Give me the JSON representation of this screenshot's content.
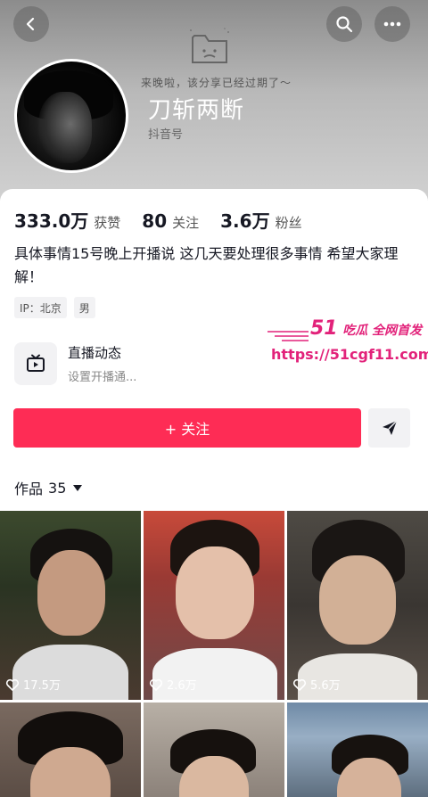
{
  "header": {
    "expired_text": "来晚啦，该分享已经过期了～",
    "nickname": "刀斩两断",
    "douyin_id_label": "抖音号"
  },
  "stats": [
    {
      "value": "333.0万",
      "label": "获赞"
    },
    {
      "value": "80",
      "label": "关注"
    },
    {
      "value": "3.6万",
      "label": "粉丝"
    }
  ],
  "bio": "具体事情15号晚上开播说 这几天要处理很多事情 希望大家理解！",
  "tags": [
    "IP：北京",
    "男"
  ],
  "watermark": {
    "brand_num": "51",
    "brand_text": "吃瓜 全网首发",
    "url": "https://51cgf11.com"
  },
  "live": {
    "title": "直播动态",
    "subtitle": "设置开播通..."
  },
  "follow_label": "+ 关注",
  "works": {
    "label": "作品",
    "count": "35"
  },
  "videos": [
    {
      "likes": "17.5万"
    },
    {
      "likes": "2.6万"
    },
    {
      "likes": "5.6万"
    },
    {
      "likes": ""
    },
    {
      "likes": ""
    },
    {
      "likes": ""
    }
  ],
  "colors": {
    "accent": "#fe2c55",
    "watermark": "#e2227a"
  },
  "icons": [
    "back-icon",
    "search-icon",
    "more-icon",
    "expired-folder-icon",
    "live-tv-icon",
    "share-send-icon",
    "heart-icon"
  ]
}
